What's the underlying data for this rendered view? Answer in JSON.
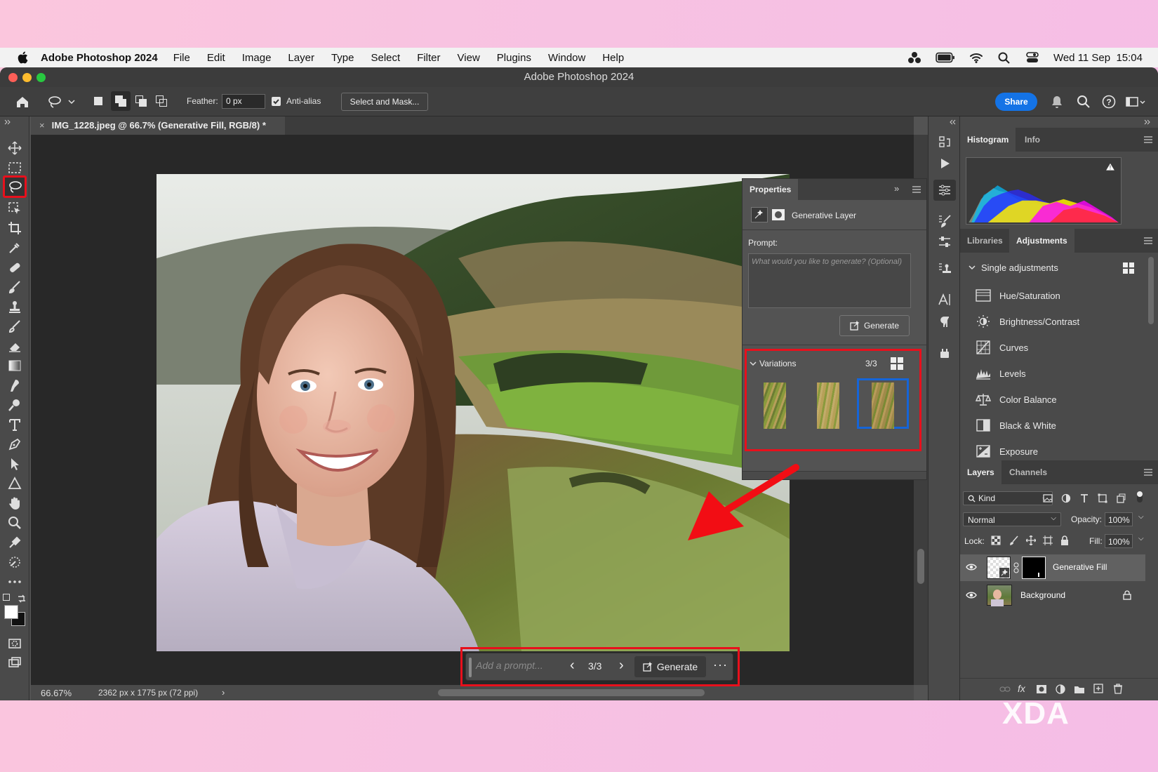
{
  "menubar": {
    "app_name": "Adobe Photoshop 2024",
    "items": [
      "File",
      "Edit",
      "Image",
      "Layer",
      "Type",
      "Select",
      "Filter",
      "View",
      "Plugins",
      "Window",
      "Help"
    ],
    "datetime": "Wed 11 Sep  15:04"
  },
  "window": {
    "title": "Adobe Photoshop 2024"
  },
  "options_bar": {
    "feather_label": "Feather:",
    "feather_value": "0 px",
    "anti_alias_label": "Anti-alias",
    "select_mask_label": "Select and Mask...",
    "share_label": "Share"
  },
  "document": {
    "tab_title": "IMG_1228.jpeg @ 66.7% (Generative Fill, RGB/8) *",
    "zoom": "66.67%",
    "dimensions": "2362 px x 1775 px (72 ppi)"
  },
  "properties": {
    "title": "Properties",
    "layer_type": "Generative Layer",
    "prompt_label": "Prompt:",
    "prompt_placeholder": "What would you like to generate? (Optional)",
    "generate_label": "Generate",
    "variations_label": "Variations",
    "variations_count": "3/3"
  },
  "taskbar": {
    "placeholder": "Add a prompt...",
    "counter": "3/3",
    "generate_label": "Generate"
  },
  "panels": {
    "histogram_tabs": [
      "Histogram",
      "Info"
    ],
    "adjust_tabs": [
      "Libraries",
      "Adjustments"
    ],
    "single_adjustments": "Single adjustments",
    "adjustments": [
      "Hue/Saturation",
      "Brightness/Contrast",
      "Curves",
      "Levels",
      "Color Balance",
      "Black & White",
      "Exposure"
    ],
    "layer_tabs": [
      "Layers",
      "Channels"
    ],
    "kind_label": "Kind",
    "blend_mode": "Normal",
    "opacity_label": "Opacity:",
    "opacity_value": "100%",
    "lock_label": "Lock:",
    "fill_label": "Fill:",
    "fill_value": "100%",
    "layers": [
      "Generative Fill",
      "Background"
    ]
  },
  "watermark": "XDA",
  "colors": {
    "accent": "#1473e6",
    "highlight": "#e8101c",
    "selection": "#1565d8"
  }
}
